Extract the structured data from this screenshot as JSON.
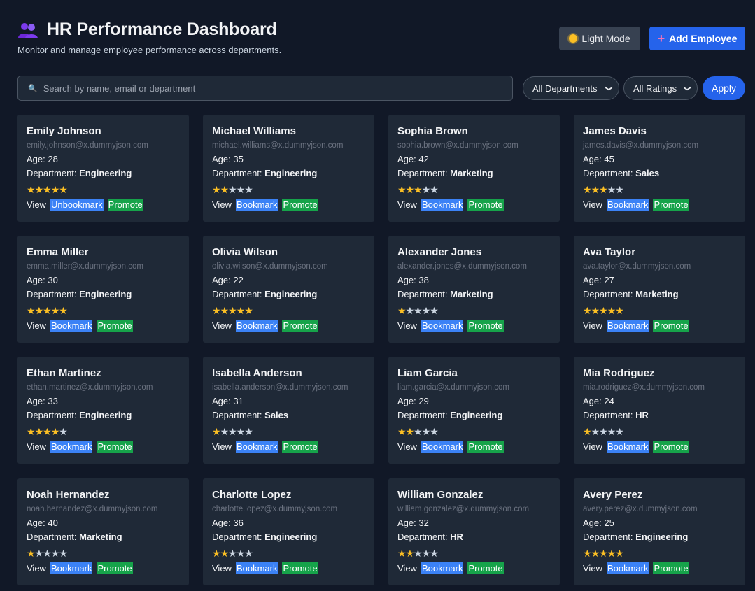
{
  "header": {
    "title": "HR Performance Dashboard",
    "subtitle": "Monitor and manage employee performance across departments.",
    "icon": "people-icon",
    "light_mode_label": "Light Mode",
    "add_employee_label": "Add Employee"
  },
  "filters": {
    "search_placeholder": "Search by name, email or department",
    "department_selected": "All Departments",
    "rating_selected": "All Ratings",
    "apply_label": "Apply"
  },
  "labels": {
    "age_prefix": "Age: ",
    "department_prefix": "Department: ",
    "view": "View",
    "promote": "Promote"
  },
  "colors": {
    "background": "#111827",
    "card": "#1f2937",
    "primary": "#2563eb",
    "bookmark": "#3b82f6",
    "promote": "#16a34a",
    "star": "#fbbf24"
  },
  "employees": [
    {
      "name": "Emily Johnson",
      "email": "emily.johnson@x.dummyjson.com",
      "age": "28",
      "department": "Engineering",
      "rating": 5,
      "bookmark_label": "Unbookmark"
    },
    {
      "name": "Michael Williams",
      "email": "michael.williams@x.dummyjson.com",
      "age": "35",
      "department": "Engineering",
      "rating": 2,
      "bookmark_label": "Bookmark"
    },
    {
      "name": "Sophia Brown",
      "email": "sophia.brown@x.dummyjson.com",
      "age": "42",
      "department": "Marketing",
      "rating": 3,
      "bookmark_label": "Bookmark"
    },
    {
      "name": "James Davis",
      "email": "james.davis@x.dummyjson.com",
      "age": "45",
      "department": "Sales",
      "rating": 3,
      "bookmark_label": "Bookmark"
    },
    {
      "name": "Emma Miller",
      "email": "emma.miller@x.dummyjson.com",
      "age": "30",
      "department": "Engineering",
      "rating": 5,
      "bookmark_label": "Bookmark"
    },
    {
      "name": "Olivia Wilson",
      "email": "olivia.wilson@x.dummyjson.com",
      "age": "22",
      "department": "Engineering",
      "rating": 5,
      "bookmark_label": "Bookmark"
    },
    {
      "name": "Alexander Jones",
      "email": "alexander.jones@x.dummyjson.com",
      "age": "38",
      "department": "Marketing",
      "rating": 1,
      "bookmark_label": "Bookmark"
    },
    {
      "name": "Ava Taylor",
      "email": "ava.taylor@x.dummyjson.com",
      "age": "27",
      "department": "Marketing",
      "rating": 5,
      "bookmark_label": "Bookmark"
    },
    {
      "name": "Ethan Martinez",
      "email": "ethan.martinez@x.dummyjson.com",
      "age": "33",
      "department": "Engineering",
      "rating": 4,
      "bookmark_label": "Bookmark"
    },
    {
      "name": "Isabella Anderson",
      "email": "isabella.anderson@x.dummyjson.com",
      "age": "31",
      "department": "Sales",
      "rating": 1,
      "bookmark_label": "Bookmark"
    },
    {
      "name": "Liam Garcia",
      "email": "liam.garcia@x.dummyjson.com",
      "age": "29",
      "department": "Engineering",
      "rating": 2,
      "bookmark_label": "Bookmark"
    },
    {
      "name": "Mia Rodriguez",
      "email": "mia.rodriguez@x.dummyjson.com",
      "age": "24",
      "department": "HR",
      "rating": 1,
      "bookmark_label": "Bookmark"
    },
    {
      "name": "Noah Hernandez",
      "email": "noah.hernandez@x.dummyjson.com",
      "age": "40",
      "department": "Marketing",
      "rating": 1,
      "bookmark_label": "Bookmark"
    },
    {
      "name": "Charlotte Lopez",
      "email": "charlotte.lopez@x.dummyjson.com",
      "age": "36",
      "department": "Engineering",
      "rating": 2,
      "bookmark_label": "Bookmark"
    },
    {
      "name": "William Gonzalez",
      "email": "william.gonzalez@x.dummyjson.com",
      "age": "32",
      "department": "HR",
      "rating": 2,
      "bookmark_label": "Bookmark"
    },
    {
      "name": "Avery Perez",
      "email": "avery.perez@x.dummyjson.com",
      "age": "25",
      "department": "Engineering",
      "rating": 5,
      "bookmark_label": "Bookmark"
    }
  ]
}
